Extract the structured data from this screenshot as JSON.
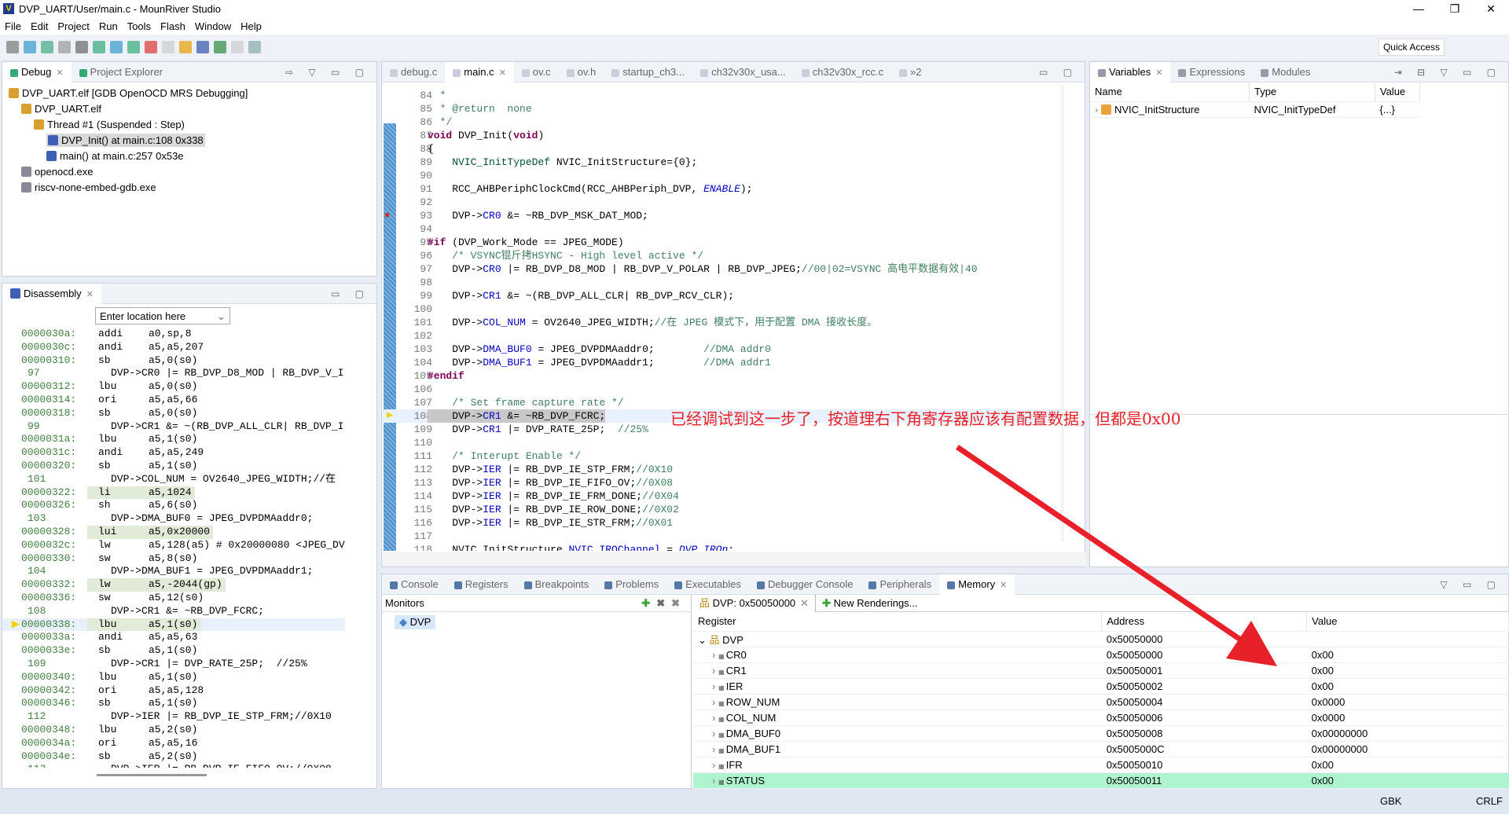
{
  "window": {
    "title": "DVP_UART/User/main.c - MounRiver Studio",
    "logo": "V"
  },
  "menu": [
    "File",
    "Edit",
    "Project",
    "Run",
    "Tools",
    "Flash",
    "Window",
    "Help"
  ],
  "toolbar": {
    "quick_access": "Quick Access"
  },
  "debug_panel": {
    "tabs": [
      {
        "label": "Debug",
        "active": true
      },
      {
        "label": "Project Explorer",
        "active": false
      }
    ],
    "tree": [
      {
        "label": "DVP_UART.elf [GDB OpenOCD MRS Debugging]",
        "level": 0,
        "icon": "launch-icon"
      },
      {
        "label": "DVP_UART.elf",
        "level": 1,
        "icon": "process-icon"
      },
      {
        "label": "Thread #1 (Suspended : Step)",
        "level": 2,
        "icon": "thread-icon"
      },
      {
        "label": "DVP_Init() at main.c:108 0x338",
        "level": 3,
        "icon": "stack-frame-icon",
        "selected": true
      },
      {
        "label": "main() at main.c:257 0x53e",
        "level": 3,
        "icon": "stack-frame-icon"
      },
      {
        "label": "openocd.exe",
        "level": 1,
        "icon": "executable-icon"
      },
      {
        "label": "riscv-none-embed-gdb.exe",
        "level": 1,
        "icon": "executable-icon"
      }
    ]
  },
  "disassembly": {
    "tab": "Disassembly",
    "location_placeholder": "Enter location here",
    "rows": [
      {
        "addr": "0000030a:",
        "op": "addi",
        "arg": "a0,sp,8"
      },
      {
        "addr": "0000030c:",
        "op": "andi",
        "arg": "a5,a5,207"
      },
      {
        "addr": "00000310:",
        "op": "sb",
        "arg": "a5,0(s0)"
      },
      {
        "line": "97",
        "src": "DVP->CR0 |= RB_DVP_D8_MOD | RB_DVP_V_I"
      },
      {
        "addr": "00000312:",
        "op": "lbu",
        "arg": "a5,0(s0)"
      },
      {
        "addr": "00000314:",
        "op": "ori",
        "arg": "a5,a5,66"
      },
      {
        "addr": "00000318:",
        "op": "sb",
        "arg": "a5,0(s0)"
      },
      {
        "line": "99",
        "src": "DVP->CR1 &= ~(RB_DVP_ALL_CLR| RB_DVP_I"
      },
      {
        "addr": "0000031a:",
        "op": "lbu",
        "arg": "a5,1(s0)"
      },
      {
        "addr": "0000031c:",
        "op": "andi",
        "arg": "a5,a5,249"
      },
      {
        "addr": "00000320:",
        "op": "sb",
        "arg": "a5,1(s0)"
      },
      {
        "line": "101",
        "src": "DVP->COL_NUM = OV2640_JPEG_WIDTH;//在"
      },
      {
        "addr": "00000322:",
        "op": "li",
        "arg": "a5,1024",
        "hl": true
      },
      {
        "addr": "00000326:",
        "op": "sh",
        "arg": "a5,6(s0)"
      },
      {
        "line": "103",
        "src": "DVP->DMA_BUF0 = JPEG_DVPDMAaddr0;"
      },
      {
        "addr": "00000328:",
        "op": "lui",
        "arg": "a5,0x20000",
        "hl": true
      },
      {
        "addr": "0000032c:",
        "op": "lw",
        "arg": "a5,128(a5) # 0x20000080 <JPEG_DV"
      },
      {
        "addr": "00000330:",
        "op": "sw",
        "arg": "a5,8(s0)"
      },
      {
        "line": "104",
        "src": "DVP->DMA_BUF1 = JPEG_DVPDMAaddr1;"
      },
      {
        "addr": "00000332:",
        "op": "lw",
        "arg": "a5,-2044(gp)",
        "hl": true
      },
      {
        "addr": "00000336:",
        "op": "sw",
        "arg": "a5,12(s0)"
      },
      {
        "line": "108",
        "src": "DVP->CR1 &= ~RB_DVP_FCRC;"
      },
      {
        "addr": "00000338:",
        "op": "lbu",
        "arg": "a5,1(s0)",
        "hl": true,
        "current": true
      },
      {
        "addr": "0000033a:",
        "op": "andi",
        "arg": "a5,a5,63"
      },
      {
        "addr": "0000033e:",
        "op": "sb",
        "arg": "a5,1(s0)"
      },
      {
        "line": "109",
        "src": "DVP->CR1 |= DVP_RATE_25P;  //25%"
      },
      {
        "addr": "00000340:",
        "op": "lbu",
        "arg": "a5,1(s0)"
      },
      {
        "addr": "00000342:",
        "op": "ori",
        "arg": "a5,a5,128"
      },
      {
        "addr": "00000346:",
        "op": "sb",
        "arg": "a5,1(s0)"
      },
      {
        "line": "112",
        "src": "DVP->IER |= RB_DVP_IE_STP_FRM;//0X10"
      },
      {
        "addr": "00000348:",
        "op": "lbu",
        "arg": "a5,2(s0)"
      },
      {
        "addr": "0000034a:",
        "op": "ori",
        "arg": "a5,a5,16"
      },
      {
        "addr": "0000034e:",
        "op": "sb",
        "arg": "a5,2(s0)"
      },
      {
        "line": "113",
        "src": "DVP->IER |= RB_DVP_IE_FIFO_OV;//0X08"
      }
    ]
  },
  "editor": {
    "tabs": [
      {
        "label": "debug.c"
      },
      {
        "label": "main.c",
        "active": true
      },
      {
        "label": "ov.c"
      },
      {
        "label": "ov.h"
      },
      {
        "label": "startup_ch3..."
      },
      {
        "label": "ch32v30x_usa..."
      },
      {
        "label": "ch32v30x_rcc.c"
      },
      {
        "label": "»2"
      }
    ],
    "breakpoint_line": "93",
    "current_line": "108",
    "lines": [
      {
        "n": "84",
        "s": [
          [
            "  *",
            "cm"
          ]
        ]
      },
      {
        "n": "85",
        "s": [
          [
            "  * @return  none",
            "cm"
          ]
        ]
      },
      {
        "n": "86",
        "s": [
          [
            "  */",
            "cm"
          ]
        ]
      },
      {
        "n": "87",
        "s": [
          [
            "void",
            "kw"
          ],
          [
            " DVP_Init(",
            ""
          ],
          [
            "void",
            "kw"
          ],
          [
            ")",
            ""
          ]
        ]
      },
      {
        "n": "88",
        "s": [
          [
            "{",
            ""
          ]
        ]
      },
      {
        "n": "89",
        "s": [
          [
            "    ",
            ""
          ],
          [
            "NVIC_InitTypeDef",
            "ty"
          ],
          [
            " NVIC_InitStructure={0};",
            ""
          ]
        ]
      },
      {
        "n": "90",
        "s": []
      },
      {
        "n": "91",
        "s": [
          [
            "    RCC_AHBPeriphClockCmd(RCC_AHBPeriph_DVP, ",
            ""
          ],
          [
            "ENABLE",
            "en"
          ],
          [
            ");",
            ""
          ]
        ]
      },
      {
        "n": "92",
        "s": []
      },
      {
        "n": "93",
        "s": [
          [
            "    DVP->",
            ""
          ],
          [
            "CR0",
            "fld"
          ],
          [
            " &= ~RB_DVP_MSK_DAT_MOD;",
            ""
          ]
        ]
      },
      {
        "n": "94",
        "s": []
      },
      {
        "n": "95",
        "s": [
          [
            "#if",
            "pp"
          ],
          [
            " (DVP_Work_Mode == JPEG_MODE)",
            ""
          ]
        ]
      },
      {
        "n": "96",
        "s": [
          [
            "    /* VSYNC锟斤拷HSYNC - High level active */",
            "cm"
          ]
        ]
      },
      {
        "n": "97",
        "s": [
          [
            "    DVP->",
            ""
          ],
          [
            "CR0",
            "fld"
          ],
          [
            " |= RB_DVP_D8_MOD | RB_DVP_V_POLAR | RB_DVP_JPEG;",
            ""
          ],
          [
            "//00|02=VSYNC 高电平数据有效|40",
            "cm"
          ]
        ]
      },
      {
        "n": "98",
        "s": []
      },
      {
        "n": "99",
        "s": [
          [
            "    DVP->",
            ""
          ],
          [
            "CR1",
            "fld"
          ],
          [
            " &= ~(RB_DVP_ALL_CLR| RB_DVP_RCV_CLR);",
            ""
          ]
        ]
      },
      {
        "n": "100",
        "s": []
      },
      {
        "n": "101",
        "s": [
          [
            "    DVP->",
            ""
          ],
          [
            "COL_NUM",
            "fld"
          ],
          [
            " = OV2640_JPEG_WIDTH;",
            ""
          ],
          [
            "//在 JPEG 模式下，用于配置 DMA 接收长度。",
            "cm"
          ]
        ]
      },
      {
        "n": "102",
        "s": []
      },
      {
        "n": "103",
        "s": [
          [
            "    DVP->",
            ""
          ],
          [
            "DMA_BUF0",
            "fld"
          ],
          [
            " = JPEG_DVPDMAaddr0;        ",
            ""
          ],
          [
            "//DMA addr0",
            "cm"
          ]
        ]
      },
      {
        "n": "104",
        "s": [
          [
            "    DVP->",
            ""
          ],
          [
            "DMA_BUF1",
            "fld"
          ],
          [
            " = JPEG_DVPDMAaddr1;        ",
            ""
          ],
          [
            "//DMA addr1",
            "cm"
          ]
        ]
      },
      {
        "n": "105",
        "s": [
          [
            "#endif",
            "pp"
          ]
        ]
      },
      {
        "n": "106",
        "s": []
      },
      {
        "n": "107",
        "s": [
          [
            "    /* Set frame capture rate */",
            "cm"
          ]
        ]
      },
      {
        "n": "108",
        "s": [
          [
            "    DVP->",
            ""
          ],
          [
            "CR1",
            "fld"
          ],
          [
            " &= ~RB_DVP_FCRC;",
            ""
          ]
        ]
      },
      {
        "n": "109",
        "s": [
          [
            "    DVP->",
            ""
          ],
          [
            "CR1",
            "fld"
          ],
          [
            " |= DVP_RATE_25P;  ",
            ""
          ],
          [
            "//25%",
            "cm"
          ]
        ]
      },
      {
        "n": "110",
        "s": []
      },
      {
        "n": "111",
        "s": [
          [
            "    /* Interupt Enable */",
            "cm"
          ]
        ]
      },
      {
        "n": "112",
        "s": [
          [
            "    DVP->",
            ""
          ],
          [
            "IER",
            "fld"
          ],
          [
            " |= RB_DVP_IE_STP_FRM;",
            ""
          ],
          [
            "//0X10",
            "cm"
          ]
        ]
      },
      {
        "n": "113",
        "s": [
          [
            "    DVP->",
            ""
          ],
          [
            "IER",
            "fld"
          ],
          [
            " |= RB_DVP_IE_FIFO_OV;",
            ""
          ],
          [
            "//0X08",
            "cm"
          ]
        ]
      },
      {
        "n": "114",
        "s": [
          [
            "    DVP->",
            ""
          ],
          [
            "IER",
            "fld"
          ],
          [
            " |= RB_DVP_IE_FRM_DONE;",
            ""
          ],
          [
            "//0X04",
            "cm"
          ]
        ]
      },
      {
        "n": "115",
        "s": [
          [
            "    DVP->",
            ""
          ],
          [
            "IER",
            "fld"
          ],
          [
            " |= RB_DVP_IE_ROW_DONE;",
            ""
          ],
          [
            "//0X02",
            "cm"
          ]
        ]
      },
      {
        "n": "116",
        "s": [
          [
            "    DVP->",
            ""
          ],
          [
            "IER",
            "fld"
          ],
          [
            " |= RB_DVP_IE_STR_FRM;",
            ""
          ],
          [
            "//0X01",
            "cm"
          ]
        ]
      },
      {
        "n": "117",
        "s": []
      },
      {
        "n": "118",
        "s": [
          [
            "    NVIC_InitStructure.",
            ""
          ],
          [
            "NVIC_IRQChannel",
            "fld"
          ],
          [
            " = ",
            ""
          ],
          [
            "DVP_IRQn",
            "en"
          ],
          [
            ";",
            ""
          ]
        ]
      }
    ]
  },
  "annotation": {
    "text": "已经调试到这一步了，按道理右下角寄存器应该有配置数据，但都是0x00",
    "color": "#e8202a"
  },
  "variables": {
    "tabs": [
      {
        "label": "Variables",
        "active": true
      },
      {
        "label": "Expressions"
      },
      {
        "label": "Modules"
      }
    ],
    "columns": [
      "Name",
      "Type",
      "Value"
    ],
    "rows": [
      {
        "name": "NVIC_InitStructure",
        "type": "NVIC_InitTypeDef",
        "value": "{...}"
      }
    ]
  },
  "bottom": {
    "tabs": [
      {
        "label": "Console"
      },
      {
        "label": "Registers"
      },
      {
        "label": "Breakpoints"
      },
      {
        "label": "Problems"
      },
      {
        "label": "Executables"
      },
      {
        "label": "Debugger Console"
      },
      {
        "label": "Peripherals"
      },
      {
        "label": "Memory",
        "active": true
      }
    ],
    "monitors_label": "Monitors",
    "monitors": [
      "DVP"
    ],
    "rendering_tab": "DVP: 0x50050000",
    "new_renderings": "New Renderings...",
    "columns": [
      "Register",
      "Address",
      "Value"
    ],
    "group": {
      "name": "DVP",
      "address": "0x50050000"
    },
    "registers": [
      {
        "name": "CR0",
        "address": "0x50050000",
        "value": "0x00"
      },
      {
        "name": "CR1",
        "address": "0x50050001",
        "value": "0x00"
      },
      {
        "name": "IER",
        "address": "0x50050002",
        "value": "0x00"
      },
      {
        "name": "ROW_NUM",
        "address": "0x50050004",
        "value": "0x0000"
      },
      {
        "name": "COL_NUM",
        "address": "0x50050006",
        "value": "0x0000"
      },
      {
        "name": "DMA_BUF0",
        "address": "0x50050008",
        "value": "0x00000000"
      },
      {
        "name": "DMA_BUF1",
        "address": "0x5005000C",
        "value": "0x00000000"
      },
      {
        "name": "IFR",
        "address": "0x50050010",
        "value": "0x00"
      },
      {
        "name": "STATUS",
        "address": "0x50050011",
        "value": "0x00",
        "selected": true
      }
    ]
  },
  "statusbar": {
    "encoding": "GBK",
    "line_ending": "CRLF"
  }
}
